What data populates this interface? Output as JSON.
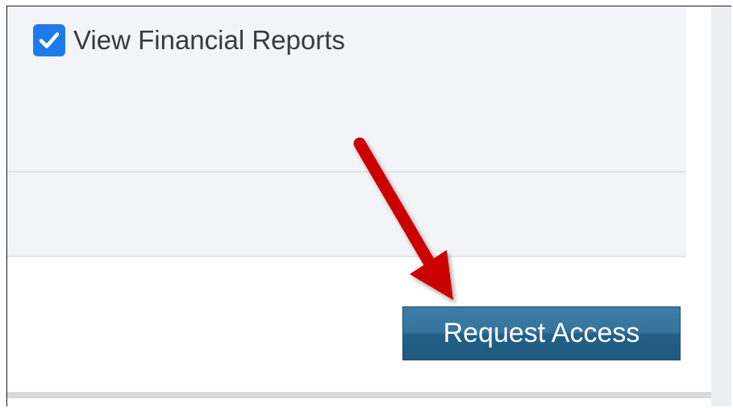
{
  "permission": {
    "label": "View Financial Reports",
    "checked": true,
    "icon": "checkmark-icon",
    "checkbox_color": "#1f7bec"
  },
  "actions": {
    "request_access_label": "Request Access",
    "button_color": "#2a6a92"
  },
  "annotation": {
    "icon": "red-arrow-icon",
    "color": "#cc0000"
  }
}
